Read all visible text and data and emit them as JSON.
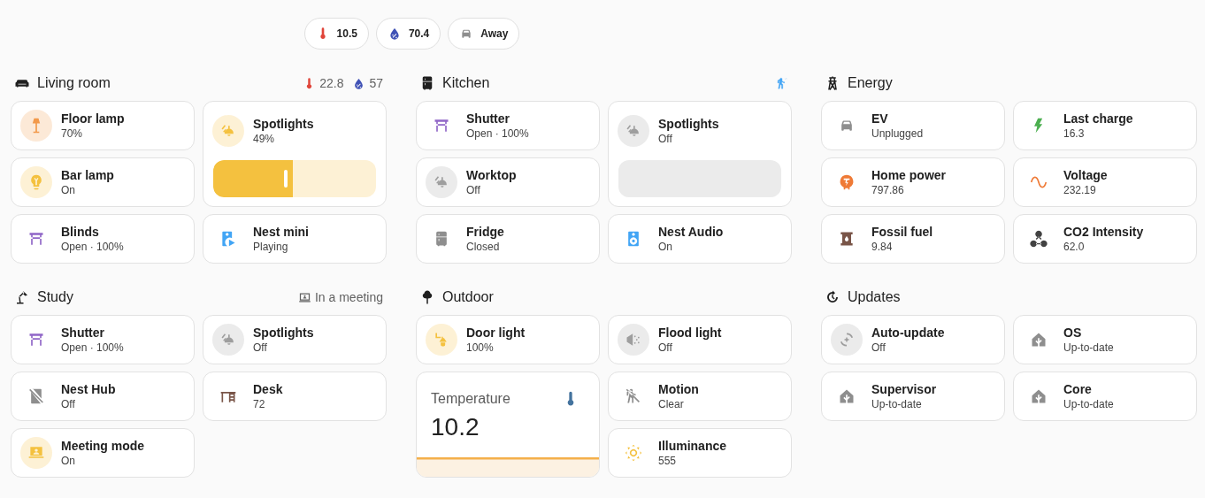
{
  "badges": [
    {
      "text": "10.5"
    },
    {
      "text": "70.4"
    },
    {
      "text": "Away"
    }
  ],
  "sections": [
    {
      "title": "Living room",
      "badges": [
        {
          "text": "22.8"
        },
        {
          "text": "57"
        }
      ],
      "cards": [
        {
          "kind": "toggle",
          "name": "Floor lamp",
          "state": "70%",
          "on": true
        },
        {
          "kind": "slider",
          "name": "Spotlights",
          "state": "49%",
          "on": true
        },
        {
          "kind": "toggle",
          "name": "Bar lamp",
          "state": "On",
          "on": true
        },
        {
          "kind": "tile",
          "name": "Blinds",
          "state": "Open · 100%"
        },
        {
          "kind": "tile",
          "name": "Nest mini",
          "state": "Playing"
        }
      ]
    },
    {
      "title": "Kitchen",
      "motion_detected": true,
      "cards": [
        {
          "kind": "tile",
          "name": "Shutter",
          "state": "Open · 100%"
        },
        {
          "kind": "slider",
          "name": "Spotlights",
          "state": "Off",
          "on": false
        },
        {
          "kind": "toggle",
          "name": "Worktop",
          "state": "Off",
          "on": false
        },
        {
          "kind": "tile",
          "name": "Fridge",
          "state": "Closed"
        },
        {
          "kind": "tile",
          "name": "Nest Audio",
          "state": "On"
        }
      ]
    },
    {
      "title": "Energy",
      "cards": [
        {
          "kind": "tile",
          "name": "EV",
          "state": "Unplugged"
        },
        {
          "kind": "tile",
          "name": "Last charge",
          "state": "16.3"
        },
        {
          "kind": "tile",
          "name": "Home power",
          "state": "797.86"
        },
        {
          "kind": "tile",
          "name": "Voltage",
          "state": "232.19"
        },
        {
          "kind": "tile",
          "name": "Fossil fuel",
          "state": "9.84"
        },
        {
          "kind": "tile",
          "name": "CO2 Intensity",
          "state": "62.0"
        }
      ]
    },
    {
      "title": "Study",
      "badges": [
        {
          "text": "In a meeting"
        }
      ],
      "cards": [
        {
          "kind": "tile",
          "name": "Shutter",
          "state": "Open · 100%"
        },
        {
          "kind": "toggle",
          "name": "Spotlights",
          "state": "Off",
          "on": false
        },
        {
          "kind": "tile",
          "name": "Nest Hub",
          "state": "Off"
        },
        {
          "kind": "tile",
          "name": "Desk",
          "state": "72"
        },
        {
          "kind": "toggle",
          "name": "Meeting mode",
          "state": "On",
          "on": true
        }
      ]
    },
    {
      "title": "Outdoor",
      "cards": [
        {
          "kind": "toggle",
          "name": "Door light",
          "state": "100%",
          "on": true
        },
        {
          "kind": "toggle",
          "name": "Flood light",
          "state": "Off",
          "on": false
        },
        {
          "kind": "sensor",
          "name": "Temperature",
          "value": "10.2"
        },
        {
          "kind": "tile",
          "name": "Motion",
          "state": "Clear"
        },
        {
          "kind": "tile",
          "name": "Illuminance",
          "state": "555"
        }
      ]
    },
    {
      "title": "Updates",
      "cards": [
        {
          "kind": "toggle",
          "name": "Auto-update",
          "state": "Off",
          "on": false
        },
        {
          "kind": "tile",
          "name": "OS",
          "state": "Up-to-date"
        },
        {
          "kind": "tile",
          "name": "Supervisor",
          "state": "Up-to-date"
        },
        {
          "kind": "tile",
          "name": "Core",
          "state": "Up-to-date"
        }
      ]
    }
  ]
}
